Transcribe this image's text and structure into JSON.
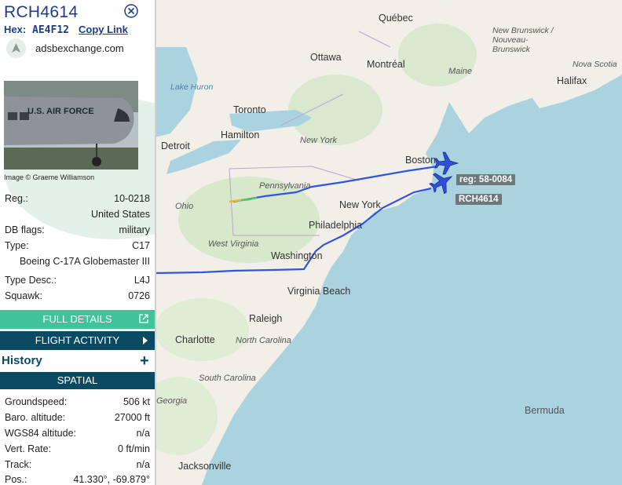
{
  "sidebar": {
    "title": "RCH4614",
    "hex_label": "Hex:",
    "hex_value": "AE4F12",
    "copy_link": "Copy Link",
    "source": "adsbexchange.com",
    "photo_text": "U.S. AIR FORCE",
    "photo_credit": "Image © Graeme Williamson",
    "fields_top": [
      {
        "key": "Reg.:",
        "value": "10-0218"
      }
    ],
    "country": "United States",
    "db_flags_label": "DB flags:",
    "db_flags_value": "military",
    "type_label": "Type:",
    "type_value": "C17",
    "type_full": "Boeing C-17A Globemaster III",
    "type_desc_label": "Type Desc.:",
    "type_desc_value": "L4J",
    "squawk_label": "Squawk:",
    "squawk_value": "0726",
    "full_details": "FULL DETAILS",
    "flight_activity": "FLIGHT ACTIVITY",
    "history": "History",
    "spatial": "SPATIAL",
    "spatial_fields": [
      {
        "key": "Groundspeed:",
        "value": "506 kt"
      },
      {
        "key": "Baro. altitude:",
        "value": "27000 ft"
      },
      {
        "key": "WGS84 altitude:",
        "value": "n/a"
      },
      {
        "key": "Vert. Rate:",
        "value": "0 ft/min"
      },
      {
        "key": "Track:",
        "value": "n/a"
      },
      {
        "key": "Pos.:",
        "value": "41.330°, -69.879°"
      }
    ]
  },
  "map": {
    "labels": {
      "quebec": "Québec",
      "ottawa": "Ottawa",
      "montreal": "Montréal",
      "maine": "Maine",
      "new_brunswick": "New Brunswick /\nNouveau-\nBrunswick",
      "nova_scotia": "Nova Scotia",
      "halifax": "Halifax",
      "lake_huron": "Lake Huron",
      "toronto": "Toronto",
      "hamilton": "Hamilton",
      "detroit": "Detroit",
      "new_york_state": "New York",
      "boston": "Boston",
      "pennsylvania": "Pennsylvania",
      "ohio": "Ohio",
      "new_york_city": "New York",
      "philadelphia": "Philadelphia",
      "west_virginia": "West Virginia",
      "washington": "Washington",
      "virginia_beach": "Virginia Beach",
      "raleigh": "Raleigh",
      "charlotte": "Charlotte",
      "north_carolina": "North Carolina",
      "south_carolina": "South Carolina",
      "georgia": "Georgia",
      "jacksonville": "Jacksonville",
      "bermuda": "Bermuda"
    },
    "aircraft_tags": {
      "reg": "reg: 58-0084",
      "callsign": "RCH4614"
    },
    "colors": {
      "track": "#3355dd",
      "land": "#f2efe9",
      "water": "#aad3df"
    }
  }
}
